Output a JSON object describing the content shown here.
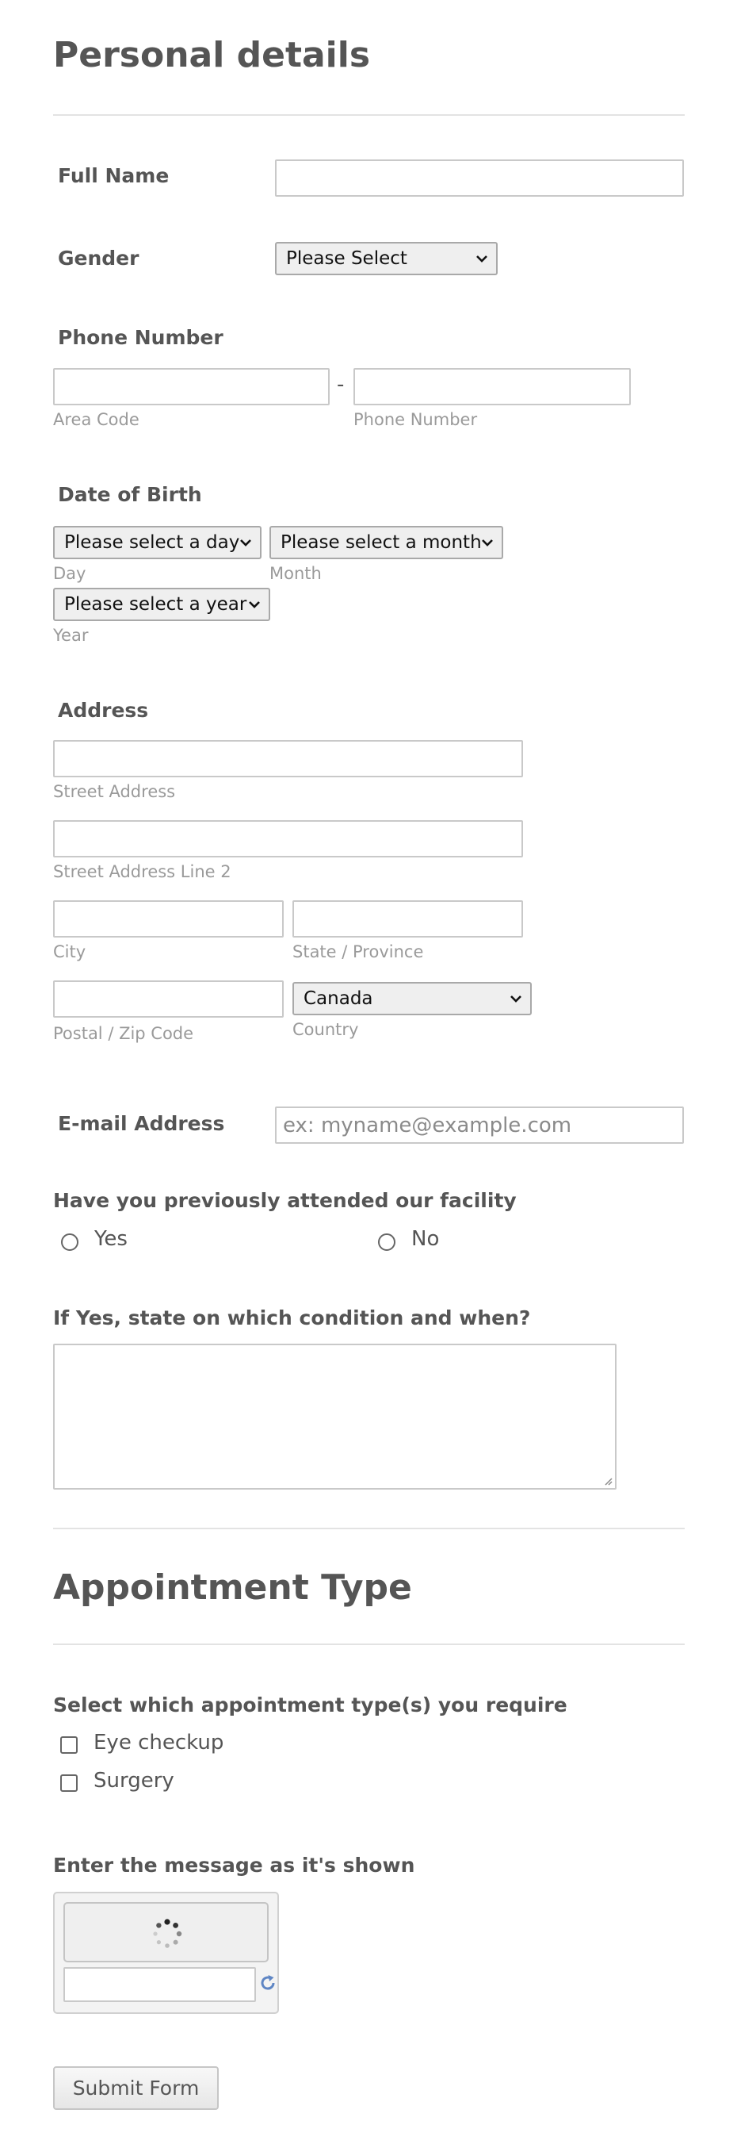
{
  "personal_details": {
    "title": "Personal details",
    "full_name": {
      "label": "Full Name",
      "value": ""
    },
    "gender": {
      "label": "Gender",
      "selected": "Please Select"
    },
    "phone": {
      "label": "Phone Number",
      "separator": "-",
      "area_code": {
        "value": "",
        "sublabel": "Area Code"
      },
      "number": {
        "value": "",
        "sublabel": "Phone Number"
      }
    },
    "dob": {
      "label": "Date of Birth",
      "day": {
        "selected": "Please select a day",
        "sublabel": "Day"
      },
      "month": {
        "selected": "Please select a month",
        "sublabel": "Month"
      },
      "year": {
        "selected": "Please select a year",
        "sublabel": "Year"
      }
    },
    "address": {
      "label": "Address",
      "street": {
        "value": "",
        "sublabel": "Street Address"
      },
      "street2": {
        "value": "",
        "sublabel": "Street Address Line 2"
      },
      "city": {
        "value": "",
        "sublabel": "City"
      },
      "state": {
        "value": "",
        "sublabel": "State / Province"
      },
      "postal": {
        "value": "",
        "sublabel": "Postal / Zip Code"
      },
      "country": {
        "selected": "Canada",
        "sublabel": "Country"
      }
    },
    "email": {
      "label": "E-mail Address",
      "placeholder": "ex: myname@example.com"
    },
    "attended": {
      "question": "Have you previously attended our facility",
      "options": [
        "Yes",
        "No"
      ]
    },
    "condition": {
      "label": "If Yes, state on which condition and when?",
      "value": ""
    }
  },
  "appointment": {
    "title": "Appointment Type",
    "question": "Select which appointment type(s) you require",
    "options": [
      "Eye checkup",
      "Surgery"
    ]
  },
  "captcha": {
    "label": "Enter the message as it's shown",
    "value": "",
    "spinner_icon": "loading-spinner-icon",
    "refresh_icon": "refresh-icon"
  },
  "submit": {
    "label": "Submit Form"
  },
  "colors": {
    "text": "#555555",
    "sublabel": "#9a9a9a",
    "border": "#c9c9c9",
    "select_bg": "#efefef"
  }
}
